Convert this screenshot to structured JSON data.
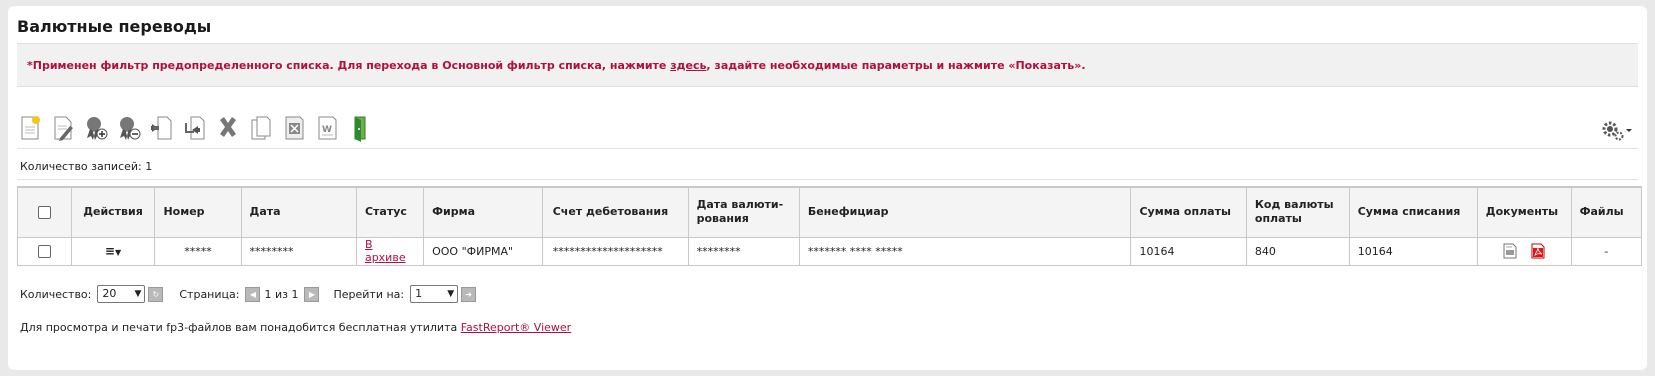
{
  "page": {
    "title": "Валютные переводы",
    "notice_before": "*Применен фильтр предопределенного списка. Для перехода в Основной фильтр списка, нажмите ",
    "notice_link": "здесь",
    "notice_after": ", задайте необходимые параметры и нажмите «Показать».",
    "records_count": "Количество записей: 1"
  },
  "toolbar": {
    "icons": [
      "new-document-icon",
      "edit-document-icon",
      "sign-add-icon",
      "sign-remove-icon",
      "send-icon",
      "receive-icon",
      "delete-icon",
      "copy-icon",
      "export-icon",
      "word-icon",
      "exit-icon"
    ],
    "settings_icon": "gear-icon"
  },
  "table": {
    "headers": {
      "actions": "Действия",
      "number": "Номер",
      "date": "Дата",
      "status": "Статус",
      "firm": "Фирма",
      "debit_account": "Счет дебетования",
      "currency_date": "Дата валюти-рования",
      "beneficiary": "Бенефициар",
      "payment_sum": "Сумма оплаты",
      "currency_code": "Код валюты оплаты",
      "debit_sum": "Сумма списания",
      "documents": "Документы",
      "files": "Файлы"
    },
    "rows": [
      {
        "number": "*****",
        "date": "********",
        "status": "В архиве",
        "firm": "ООО \"ФИРМА\"",
        "debit_account": "********************",
        "currency_date": "********",
        "beneficiary": "******* **** *****",
        "payment_sum": "10164",
        "currency_code": "840",
        "debit_sum": "10164",
        "files": "-"
      }
    ]
  },
  "pager": {
    "quantity_label": "Количество:",
    "quantity_value": "20",
    "page_label": "Страница:",
    "page_value": "1 из 1",
    "goto_label": "Перейти на:",
    "goto_value": "1"
  },
  "footer": {
    "text": "Для просмотра и печати fp3-файлов вам понадобится бесплатная утилита ",
    "link": "FastReport® Viewer"
  },
  "colors": {
    "accent": "#b0103c",
    "header_bg": "#f4f4f4",
    "notice_bg": "#f1f1f1"
  }
}
